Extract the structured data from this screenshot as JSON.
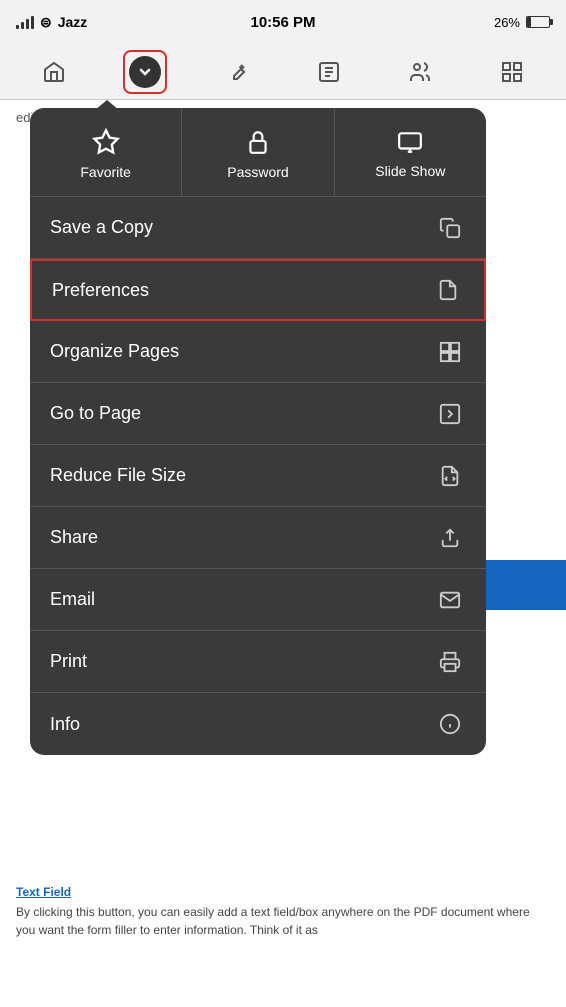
{
  "statusBar": {
    "carrier": "Jazz",
    "time": "10:56 PM",
    "battery": "26%"
  },
  "toolbar": {
    "buttons": [
      "home",
      "chevron-down",
      "pen",
      "text-edit",
      "people",
      "grid"
    ]
  },
  "bgText": "edit, and fill out multiple forms in any PDF document.",
  "dropdownMenu": {
    "topItems": [
      {
        "label": "Favorite",
        "icon": "star"
      },
      {
        "label": "Password",
        "icon": "lock"
      },
      {
        "label": "Slide Show",
        "icon": "slideshow"
      }
    ],
    "listItems": [
      {
        "label": "Save a Copy",
        "icon": "copy",
        "highlighted": false
      },
      {
        "label": "Preferences",
        "icon": "document",
        "highlighted": true
      },
      {
        "label": "Organize Pages",
        "icon": "grid",
        "highlighted": false
      },
      {
        "label": "Go to Page",
        "icon": "arrow-right",
        "highlighted": false
      },
      {
        "label": "Reduce File Size",
        "icon": "compress",
        "highlighted": false
      },
      {
        "label": "Share",
        "icon": "share",
        "highlighted": false
      },
      {
        "label": "Email",
        "icon": "email",
        "highlighted": false
      },
      {
        "label": "Print",
        "icon": "print",
        "highlighted": false
      },
      {
        "label": "Info",
        "icon": "info",
        "highlighted": false
      }
    ]
  },
  "bottomContent": {
    "label": "Text Field",
    "body": "By clicking this button, you can easily add a text field/box anywhere on the PDF document where you want the form filler to enter information. Think of it as"
  }
}
